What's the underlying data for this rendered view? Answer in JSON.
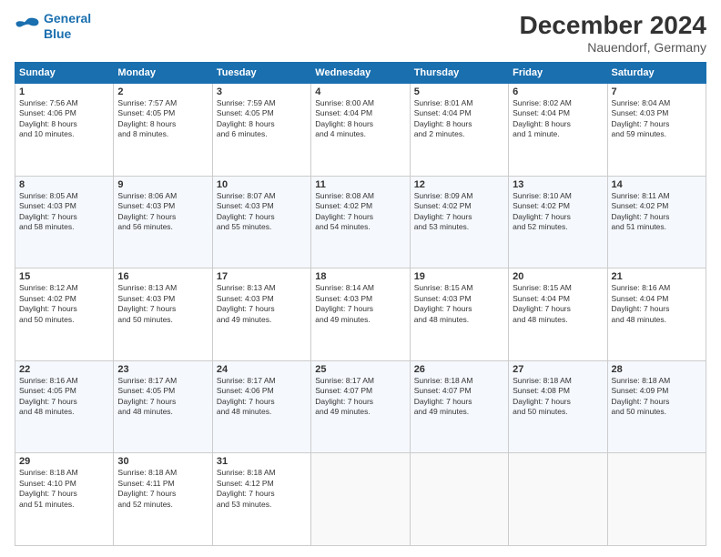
{
  "logo": {
    "line1": "General",
    "line2": "Blue"
  },
  "title": "December 2024",
  "location": "Nauendorf, Germany",
  "days_header": [
    "Sunday",
    "Monday",
    "Tuesday",
    "Wednesday",
    "Thursday",
    "Friday",
    "Saturday"
  ],
  "weeks": [
    [
      {
        "day": "1",
        "info": "Sunrise: 7:56 AM\nSunset: 4:06 PM\nDaylight: 8 hours\nand 10 minutes."
      },
      {
        "day": "2",
        "info": "Sunrise: 7:57 AM\nSunset: 4:05 PM\nDaylight: 8 hours\nand 8 minutes."
      },
      {
        "day": "3",
        "info": "Sunrise: 7:59 AM\nSunset: 4:05 PM\nDaylight: 8 hours\nand 6 minutes."
      },
      {
        "day": "4",
        "info": "Sunrise: 8:00 AM\nSunset: 4:04 PM\nDaylight: 8 hours\nand 4 minutes."
      },
      {
        "day": "5",
        "info": "Sunrise: 8:01 AM\nSunset: 4:04 PM\nDaylight: 8 hours\nand 2 minutes."
      },
      {
        "day": "6",
        "info": "Sunrise: 8:02 AM\nSunset: 4:04 PM\nDaylight: 8 hours\nand 1 minute."
      },
      {
        "day": "7",
        "info": "Sunrise: 8:04 AM\nSunset: 4:03 PM\nDaylight: 7 hours\nand 59 minutes."
      }
    ],
    [
      {
        "day": "8",
        "info": "Sunrise: 8:05 AM\nSunset: 4:03 PM\nDaylight: 7 hours\nand 58 minutes."
      },
      {
        "day": "9",
        "info": "Sunrise: 8:06 AM\nSunset: 4:03 PM\nDaylight: 7 hours\nand 56 minutes."
      },
      {
        "day": "10",
        "info": "Sunrise: 8:07 AM\nSunset: 4:03 PM\nDaylight: 7 hours\nand 55 minutes."
      },
      {
        "day": "11",
        "info": "Sunrise: 8:08 AM\nSunset: 4:02 PM\nDaylight: 7 hours\nand 54 minutes."
      },
      {
        "day": "12",
        "info": "Sunrise: 8:09 AM\nSunset: 4:02 PM\nDaylight: 7 hours\nand 53 minutes."
      },
      {
        "day": "13",
        "info": "Sunrise: 8:10 AM\nSunset: 4:02 PM\nDaylight: 7 hours\nand 52 minutes."
      },
      {
        "day": "14",
        "info": "Sunrise: 8:11 AM\nSunset: 4:02 PM\nDaylight: 7 hours\nand 51 minutes."
      }
    ],
    [
      {
        "day": "15",
        "info": "Sunrise: 8:12 AM\nSunset: 4:02 PM\nDaylight: 7 hours\nand 50 minutes."
      },
      {
        "day": "16",
        "info": "Sunrise: 8:13 AM\nSunset: 4:03 PM\nDaylight: 7 hours\nand 50 minutes."
      },
      {
        "day": "17",
        "info": "Sunrise: 8:13 AM\nSunset: 4:03 PM\nDaylight: 7 hours\nand 49 minutes."
      },
      {
        "day": "18",
        "info": "Sunrise: 8:14 AM\nSunset: 4:03 PM\nDaylight: 7 hours\nand 49 minutes."
      },
      {
        "day": "19",
        "info": "Sunrise: 8:15 AM\nSunset: 4:03 PM\nDaylight: 7 hours\nand 48 minutes."
      },
      {
        "day": "20",
        "info": "Sunrise: 8:15 AM\nSunset: 4:04 PM\nDaylight: 7 hours\nand 48 minutes."
      },
      {
        "day": "21",
        "info": "Sunrise: 8:16 AM\nSunset: 4:04 PM\nDaylight: 7 hours\nand 48 minutes."
      }
    ],
    [
      {
        "day": "22",
        "info": "Sunrise: 8:16 AM\nSunset: 4:05 PM\nDaylight: 7 hours\nand 48 minutes."
      },
      {
        "day": "23",
        "info": "Sunrise: 8:17 AM\nSunset: 4:05 PM\nDaylight: 7 hours\nand 48 minutes."
      },
      {
        "day": "24",
        "info": "Sunrise: 8:17 AM\nSunset: 4:06 PM\nDaylight: 7 hours\nand 48 minutes."
      },
      {
        "day": "25",
        "info": "Sunrise: 8:17 AM\nSunset: 4:07 PM\nDaylight: 7 hours\nand 49 minutes."
      },
      {
        "day": "26",
        "info": "Sunrise: 8:18 AM\nSunset: 4:07 PM\nDaylight: 7 hours\nand 49 minutes."
      },
      {
        "day": "27",
        "info": "Sunrise: 8:18 AM\nSunset: 4:08 PM\nDaylight: 7 hours\nand 50 minutes."
      },
      {
        "day": "28",
        "info": "Sunrise: 8:18 AM\nSunset: 4:09 PM\nDaylight: 7 hours\nand 50 minutes."
      }
    ],
    [
      {
        "day": "29",
        "info": "Sunrise: 8:18 AM\nSunset: 4:10 PM\nDaylight: 7 hours\nand 51 minutes."
      },
      {
        "day": "30",
        "info": "Sunrise: 8:18 AM\nSunset: 4:11 PM\nDaylight: 7 hours\nand 52 minutes."
      },
      {
        "day": "31",
        "info": "Sunrise: 8:18 AM\nSunset: 4:12 PM\nDaylight: 7 hours\nand 53 minutes."
      },
      {
        "day": "",
        "info": ""
      },
      {
        "day": "",
        "info": ""
      },
      {
        "day": "",
        "info": ""
      },
      {
        "day": "",
        "info": ""
      }
    ]
  ]
}
